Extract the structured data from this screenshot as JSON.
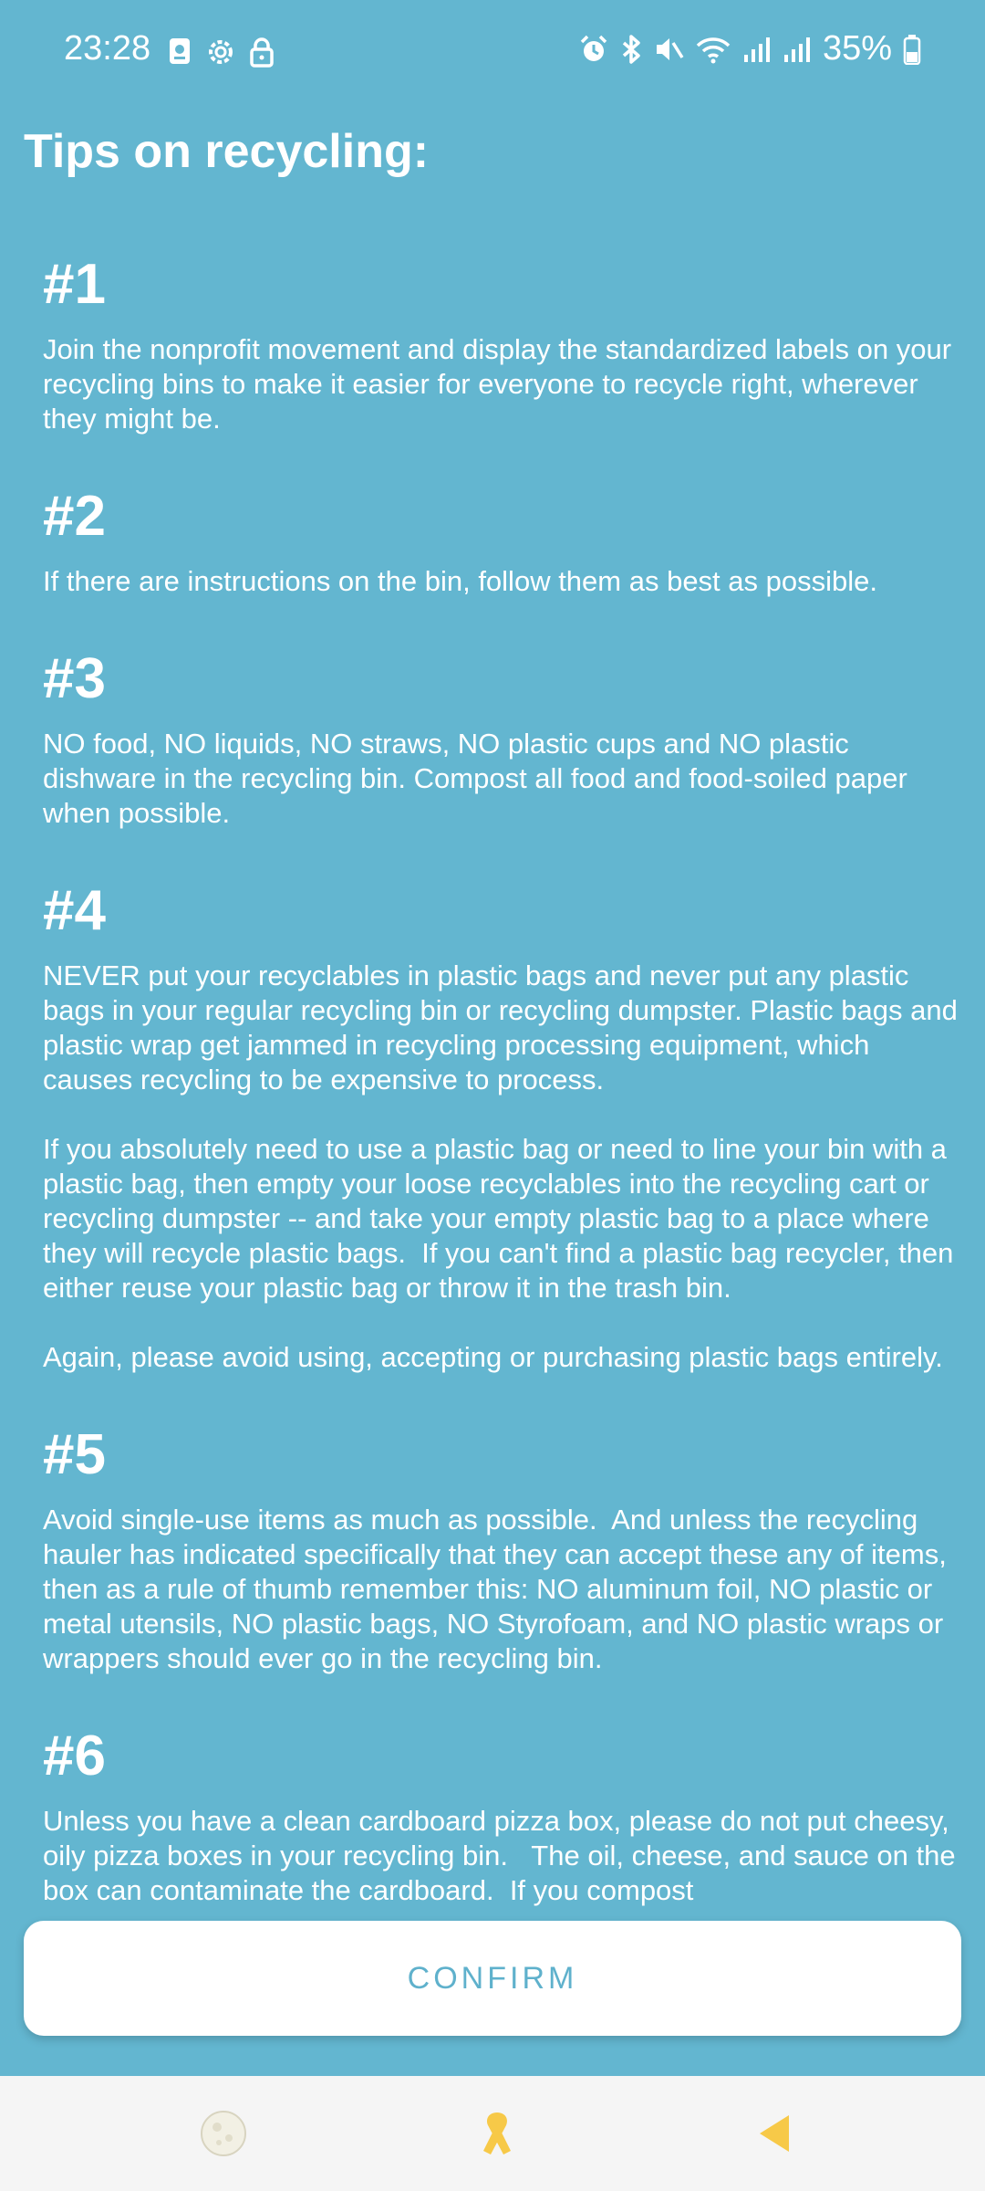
{
  "status_bar": {
    "time": "23:28",
    "battery_percent": "35%",
    "icons_left": [
      "screenshot-icon",
      "settings-gear-icon",
      "lock-icon"
    ],
    "icons_right": [
      "alarm-icon",
      "bluetooth-icon",
      "mute-icon",
      "wifi-icon",
      "signal-icon",
      "signal-icon",
      "battery-icon"
    ]
  },
  "page": {
    "title": "Tips on recycling:"
  },
  "tips": [
    {
      "number": "#1",
      "paragraphs": [
        "Join the nonprofit movement and display the standardized labels on your recycling bins to make it easier for everyone to recycle right, wherever they might be."
      ]
    },
    {
      "number": "#2",
      "paragraphs": [
        "If there are instructions on the bin, follow them as best as possible."
      ]
    },
    {
      "number": "#3",
      "paragraphs": [
        "NO food, NO liquids, NO straws, NO plastic cups and NO plastic dishware in the recycling bin. Compost all food and food-soiled paper when possible."
      ]
    },
    {
      "number": "#4",
      "paragraphs": [
        "NEVER put your recyclables in plastic bags and never put any plastic bags in your regular recycling bin or recycling dumpster. Plastic bags and plastic wrap get jammed in recycling processing equipment, which causes recycling to be expensive to process.",
        "If you absolutely need to use a plastic bag or need to line your bin with a plastic bag, then empty your loose recyclables into the recycling cart or recycling dumpster -- and take your empty plastic bag to a place where they will recycle plastic bags.  If you can't find a plastic bag recycler, then either reuse your plastic bag or throw it in the trash bin.",
        "Again, please avoid using, accepting or purchasing plastic bags entirely."
      ]
    },
    {
      "number": "#5",
      "paragraphs": [
        "Avoid single-use items as much as possible.  And unless the recycling hauler has indicated specifically that they can accept these any of items, then as a rule of thumb remember this: NO aluminum foil, NO plastic or metal utensils, NO plastic bags, NO Styrofoam, and NO plastic wraps or wrappers should ever go in the recycling bin."
      ]
    },
    {
      "number": "#6",
      "paragraphs": [
        "Unless you have a clean cardboard pizza box, please do not put cheesy, oily pizza boxes in your recycling bin.   The oil, cheese, and sauce on the box can contaminate the cardboard.  If you compost"
      ]
    }
  ],
  "confirm_button": {
    "label": "CONFIRM"
  },
  "bottom_nav": {
    "items": [
      {
        "icon": "moon-icon",
        "color": "#f2f0e4"
      },
      {
        "icon": "ribbon-icon",
        "color": "#f7c948"
      },
      {
        "icon": "back-arrow-icon",
        "color": "#f7c948"
      }
    ]
  },
  "colors": {
    "background": "#63b6d0",
    "text": "#ffffff",
    "button_text": "#5fb1cc",
    "nav_background": "#f5f5f5",
    "accent": "#f7c948"
  }
}
